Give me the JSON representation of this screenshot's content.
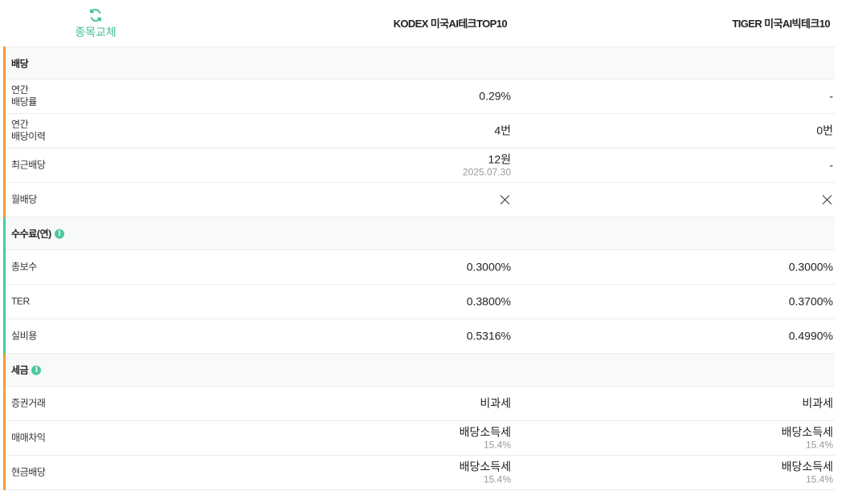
{
  "swap": {
    "label": "종목교체"
  },
  "columns": {
    "a": "KODEX 미국AI테크TOP10",
    "b": "TIGER 미국AI빅테크10"
  },
  "dividend": {
    "title": "배당",
    "rows": {
      "annual_yield": {
        "label_l1": "연간",
        "label_l2": "배당률",
        "a": "0.29%",
        "b": "-"
      },
      "annual_count": {
        "label_l1": "연간",
        "label_l2": "배당이력",
        "a": "4번",
        "b": "0번"
      },
      "recent": {
        "label": "최근배당",
        "a": "12원",
        "a_sub": "2025.07.30",
        "b": "-"
      },
      "monthly": {
        "label": "월배당",
        "a_icon": "x-icon",
        "b_icon": "x-icon"
      }
    }
  },
  "fees": {
    "title": "수수료(연)",
    "rows": {
      "total": {
        "label": "총보수",
        "a": "0.3000%",
        "b": "0.3000%"
      },
      "ter": {
        "label": "TER",
        "a": "0.3800%",
        "b": "0.3700%"
      },
      "real": {
        "label": "실비용",
        "a": "0.5316%",
        "b": "0.4990%"
      }
    }
  },
  "tax": {
    "title": "세금",
    "rows": {
      "trade": {
        "label": "증권거래",
        "a": "비과세",
        "b": "비과세"
      },
      "gain": {
        "label": "매매차익",
        "a": "배당소득세",
        "a_sub": "15.4%",
        "b": "배당소득세",
        "b_sub": "15.4%"
      },
      "cash": {
        "label": "현금배당",
        "a": "배당소득세",
        "a_sub": "15.4%",
        "b": "배당소득세",
        "b_sub": "15.4%"
      }
    }
  },
  "colors": {
    "accent_green": "#4bc99a",
    "accent_orange": "#f29a3a"
  }
}
